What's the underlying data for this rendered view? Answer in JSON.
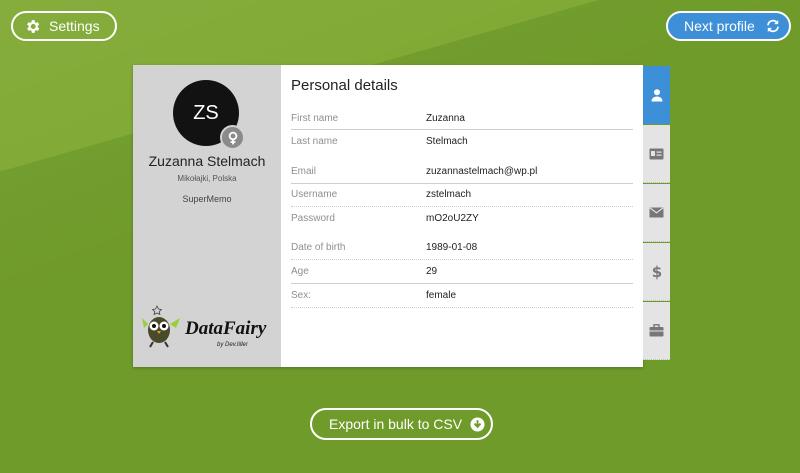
{
  "topbar": {
    "settings_label": "Settings",
    "next_label": "Next profile"
  },
  "profile": {
    "initials": "ZS",
    "full_name": "Zuzanna Stelmach",
    "location": "Mikołajki, Polska",
    "company": "SuperMemo",
    "logo_text": "DataFairy",
    "logo_sub": "by Dev.tiller",
    "gender_icon": "female-symbol-icon"
  },
  "details": {
    "title": "Personal details",
    "rows": [
      {
        "label": "First name",
        "value": "Zuzanna"
      },
      {
        "label": "Last name",
        "value": "Stelmach"
      },
      {
        "label": "Email",
        "value": "zuzannastelmach@wp.pl"
      },
      {
        "label": "Username",
        "value": "zstelmach"
      },
      {
        "label": "Password",
        "value": "mO2oU2ZY"
      },
      {
        "label": "Date of birth",
        "value": "1989-01-08"
      },
      {
        "label": "Age",
        "value": "29"
      },
      {
        "label": "Sex:",
        "value": "female"
      }
    ]
  },
  "tabs": [
    {
      "icon": "user-icon",
      "active": true
    },
    {
      "icon": "id-card-icon",
      "active": false
    },
    {
      "icon": "envelope-icon",
      "active": false
    },
    {
      "icon": "dollar-icon",
      "active": false
    },
    {
      "icon": "briefcase-icon",
      "active": false
    }
  ],
  "footer": {
    "export_label": "Export in bulk to CSV"
  },
  "colors": {
    "background": "#6f9b2a",
    "accent": "#3d8fd8",
    "panel": "#d3d3d3"
  }
}
